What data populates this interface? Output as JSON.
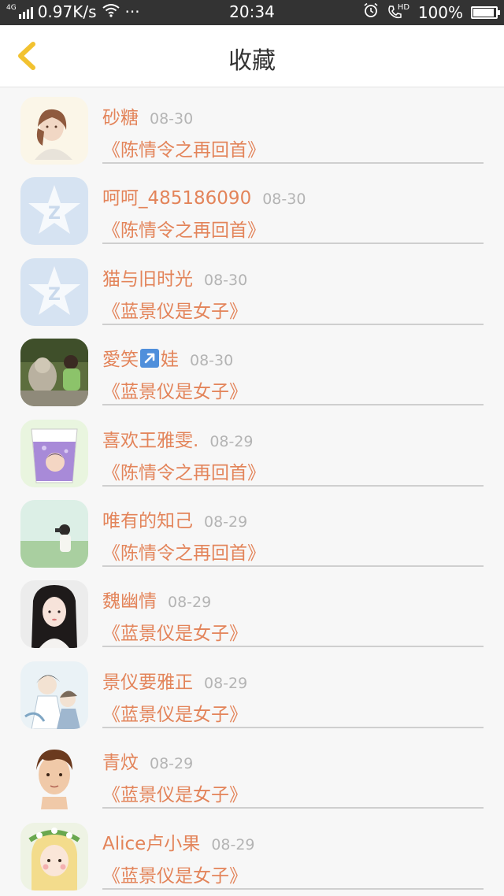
{
  "status_bar": {
    "network_type": "4G",
    "speed": "0.97K/s",
    "more": "···",
    "time": "20:34",
    "hd": "HD",
    "battery": "100%",
    "battery_level": 1.0
  },
  "header": {
    "title": "收藏"
  },
  "items": [
    {
      "name": "砂糖",
      "date": "08-30",
      "title": "《陈情令之再回首》",
      "avatar": "portrait-sketch-avatar"
    },
    {
      "name": "呵呵_485186090",
      "date": "08-30",
      "title": "《陈情令之再回首》",
      "avatar": "qq-default-avatar"
    },
    {
      "name": "猫与旧时光",
      "date": "08-30",
      "title": "《蓝景仪是女子》",
      "avatar": "qq-default-avatar"
    },
    {
      "name_before": "愛笑",
      "emoji": "arrow-up-right-emoji",
      "name_after": "娃",
      "date": "08-30",
      "title": "《蓝景仪是女子》",
      "avatar": "photo-statue-avatar"
    },
    {
      "name": "喜欢王雅雯.",
      "date": "08-29",
      "title": "《陈情令之再回首》",
      "avatar": "purple-drink-avatar"
    },
    {
      "name": "唯有的知己",
      "date": "08-29",
      "title": "《陈情令之再回首》",
      "avatar": "landscape-girl-avatar"
    },
    {
      "name": "魏幽情",
      "date": "08-29",
      "title": "《蓝景仪是女子》",
      "avatar": "costume-girl-avatar"
    },
    {
      "name": "景仪要雅正",
      "date": "08-29",
      "title": "《蓝景仪是女子》",
      "avatar": "anime-characters-avatar"
    },
    {
      "name": "青炆",
      "date": "08-29",
      "title": "《蓝景仪是女子》",
      "avatar": "cartoon-boy-avatar"
    },
    {
      "name": "Alice卢小果",
      "date": "08-29",
      "title": "《蓝景仪是女子》",
      "avatar": "flower-crown-girl-avatar"
    }
  ],
  "colors": {
    "accent": "#e3845a",
    "back_arrow": "#f2c230",
    "date": "#b4b4b4",
    "status_bar": "#333333"
  }
}
